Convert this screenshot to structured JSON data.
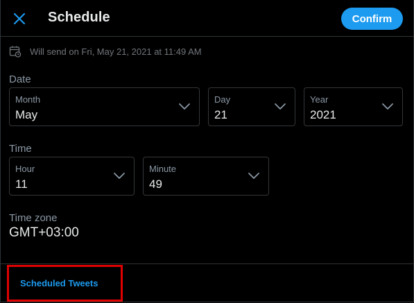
{
  "header": {
    "title": "Schedule",
    "confirm_label": "Confirm",
    "close_icon": "close-icon"
  },
  "summary": {
    "icon": "calendar-clock-icon",
    "text": "Will send on Fri, May 21, 2021 at 11:49 AM"
  },
  "date": {
    "section_label": "Date",
    "month": {
      "label": "Month",
      "value": "May"
    },
    "day": {
      "label": "Day",
      "value": "21"
    },
    "year": {
      "label": "Year",
      "value": "2021"
    }
  },
  "time": {
    "section_label": "Time",
    "hour": {
      "label": "Hour",
      "value": "11"
    },
    "minute": {
      "label": "Minute",
      "value": "49"
    }
  },
  "timezone": {
    "label": "Time zone",
    "value": "GMT+03:00"
  },
  "footer": {
    "scheduled_link": "Scheduled Tweets"
  },
  "colors": {
    "accent": "#1d9bf0",
    "background": "#000000",
    "highlight": "#e00000",
    "secondary_text": "#8b98a5"
  }
}
